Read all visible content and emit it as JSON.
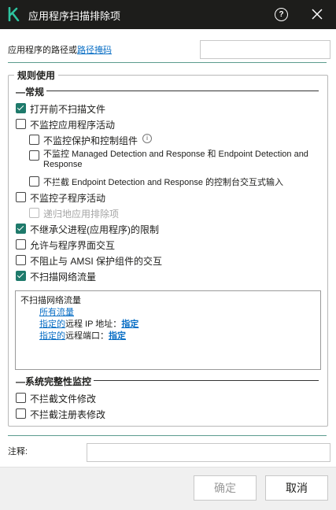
{
  "window": {
    "title": "应用程序扫描排除项",
    "logo_letter": "k",
    "accent_color": "#1e7a6b",
    "link_color": "#0a6fc5"
  },
  "path": {
    "label": "应用程序的路径或",
    "link": "路径掩码",
    "value": ""
  },
  "rules": {
    "group_title": "规则使用",
    "general_head": "常规",
    "items": [
      {
        "label": "打开前不扫描文件",
        "checked": true
      },
      {
        "label": "不监控应用程序活动",
        "checked": false
      },
      {
        "label": "不监控保护和控制组件",
        "checked": false
      },
      {
        "label": "不监控 Managed Detection and Response 和 Endpoint Detection and Response",
        "checked": false
      },
      {
        "label": "不拦截 Endpoint Detection and Response 的控制台交互式输入",
        "checked": false
      },
      {
        "label": "不监控子程序活动",
        "checked": false
      },
      {
        "label": "递归地应用排除项",
        "checked": false,
        "disabled": true
      },
      {
        "label": "不继承父进程(应用程序)的限制",
        "checked": true
      },
      {
        "label": "允许与程序界面交互",
        "checked": false
      },
      {
        "label": "不阻止与 AMSI 保护组件的交互",
        "checked": false
      },
      {
        "label": "不扫描网络流量",
        "checked": true
      }
    ],
    "description": {
      "heading": "不扫描网络流量",
      "all_traffic": "所有流量",
      "ip_prefix": "指定的",
      "ip_middle": "远程 IP 地址：",
      "ip_link": "指定",
      "port_prefix": "指定的",
      "port_middle": "远程端口：",
      "port_link": "指定"
    },
    "integrity_head": "系统完整性监控",
    "integrity_items": [
      {
        "label": "不拦截文件修改",
        "checked": false
      },
      {
        "label": "不拦截注册表修改",
        "checked": false
      }
    ]
  },
  "comment": {
    "label": "注释:",
    "value": ""
  },
  "footer": {
    "ok_label": "确定",
    "cancel_label": "取消"
  }
}
